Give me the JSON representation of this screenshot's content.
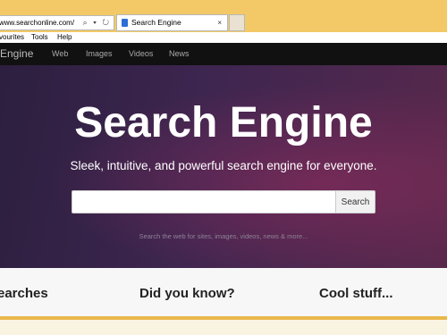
{
  "browser": {
    "address_url": "www.searchonline.com/",
    "address_icons": "⌕ ▾ ↻",
    "tab_title": "Search Engine",
    "tab_close": "×",
    "menu": [
      "vourites",
      "Tools",
      "Help"
    ]
  },
  "site_nav": {
    "brand": "Engine",
    "links": [
      "Web",
      "Images",
      "Videos",
      "News"
    ]
  },
  "hero": {
    "title": "Search Engine",
    "subtitle": "Sleek, intuitive, and powerful search engine for everyone.",
    "search_placeholder": "",
    "search_button": "Search",
    "hint": "Search the web for sites, images, videos, news & more..."
  },
  "sections": [
    "earches",
    "Did you know?",
    "Cool stuff..."
  ]
}
